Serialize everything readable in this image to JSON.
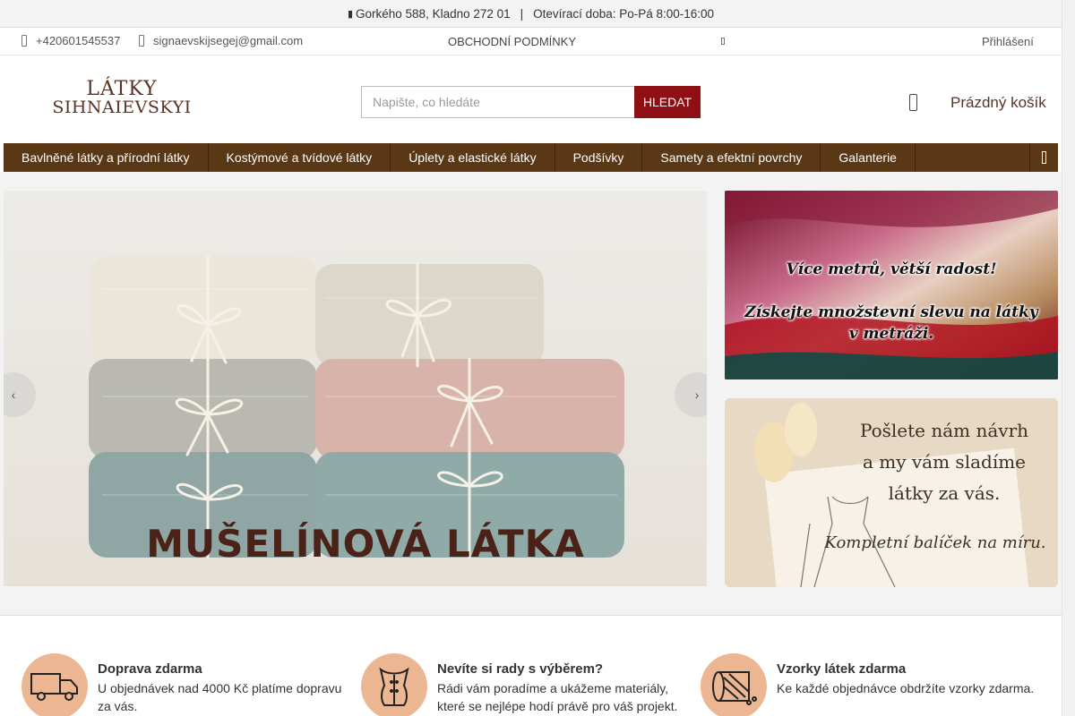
{
  "topbar": {
    "address": "Gorkého 588, Kladno 272 01",
    "separator": "|",
    "hours": "Otevírací doba: Po-Pá 8:00-16:00"
  },
  "contact": {
    "phone": "+420601545537",
    "email": "signaevskijsegej@gmail.com",
    "terms": "OBCHODNÍ PODMÍNKY",
    "login": "Přihlášení"
  },
  "logo": {
    "line1": "LÁTKY",
    "line2": "SIHNAIEVSKYI"
  },
  "search": {
    "placeholder": "Napište, co hledáte",
    "value": "",
    "button": "HLEDAT"
  },
  "cart": {
    "label": "Prázdný košík",
    "icon": "cart-icon"
  },
  "nav": {
    "items": [
      "Bavlněné látky a přírodní látky",
      "Kostýmové a tvídové látky",
      "Úplety a elastické látky",
      "Podšívky",
      "Samety a efektní povrchy",
      "Galanterie"
    ],
    "toggle_icon": "menu-icon"
  },
  "slider": {
    "caption": "MUŠELÍNOVÁ LÁTKA",
    "prev_icon": "chevron-left-icon",
    "next_icon": "chevron-right-icon"
  },
  "banners": {
    "first": {
      "line1": "Více metrů, větší radost!",
      "line2": "Získejte množstevní slevu na látky",
      "line3": "v metráži."
    },
    "second": {
      "line1": "Pošlete nám návrh",
      "line2": "a my vám sladíme",
      "line3": "látky za vás.",
      "line4": "Kompletní balíček na míru."
    }
  },
  "features": [
    {
      "title": "Doprava zdarma",
      "text": "U objednávek nad 4000 Kč platíme dopravu za vás.",
      "icon": "truck-icon"
    },
    {
      "title": "Nevíte si rady s výběrem?",
      "text": "Rádi vám poradíme a ukážeme materiály, které se nejlépe hodí právě pro váš projekt.",
      "icon": "corset-icon"
    },
    {
      "title": "Vzorky látek zdarma",
      "text": "Ke každé objednávce obdržíte vzorky zdarma.",
      "icon": "fabric-roll-icon"
    }
  ],
  "colors": {
    "brand_brown": "#5a3715",
    "search_button": "#8e0f14",
    "feature_circle": "#edb693",
    "caption_text": "#4b2217"
  }
}
